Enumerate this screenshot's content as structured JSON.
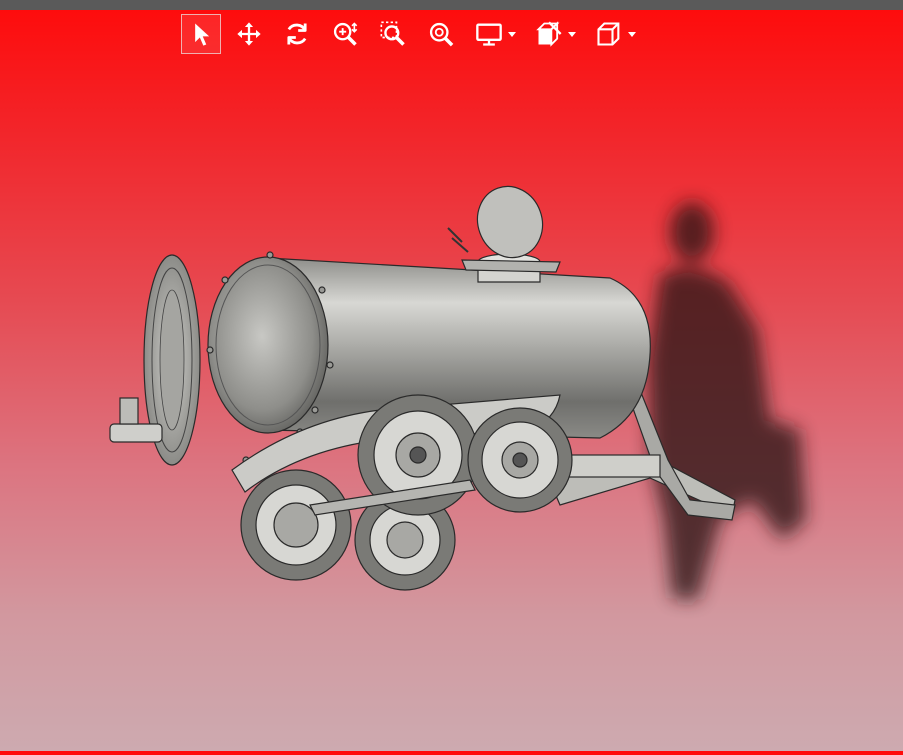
{
  "toolbar": {
    "tools": [
      {
        "id": "select",
        "icon": "cursor-arrow-icon",
        "active": true
      },
      {
        "id": "pan",
        "icon": "move-arrows-icon",
        "active": false
      },
      {
        "id": "rotate",
        "icon": "rotate-icon",
        "active": false
      },
      {
        "id": "zoom",
        "icon": "zoom-icon",
        "active": false
      },
      {
        "id": "zoom-window",
        "icon": "zoom-window-icon",
        "active": false
      },
      {
        "id": "zoom-fit",
        "icon": "zoom-fit-icon",
        "active": false
      },
      {
        "id": "display-mode",
        "icon": "monitor-icon",
        "has_dropdown": true
      },
      {
        "id": "section",
        "icon": "section-view-icon",
        "has_dropdown": true
      },
      {
        "id": "view-orientation",
        "icon": "cube-view-icon",
        "has_dropdown": true
      }
    ]
  },
  "colors": {
    "top_bar": "#5a5a5a",
    "gradient_top": "#ff0a0a",
    "gradient_bottom": "#cdaab0",
    "icon": "#ffffff",
    "model_metal": "#b8b8b4",
    "shadow": "#2e1414"
  },
  "scene": {
    "model": "tanker-trailer-3d-model",
    "shadow": "person-silhouette-shadow"
  }
}
